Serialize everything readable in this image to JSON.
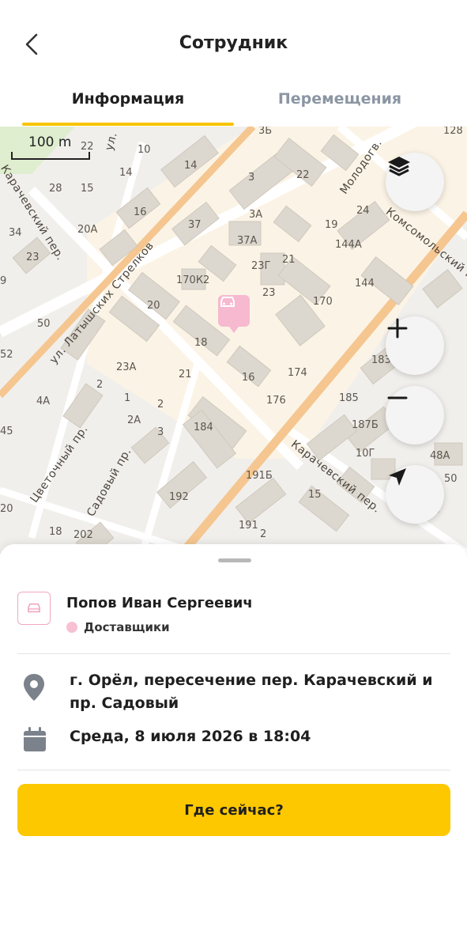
{
  "header": {
    "title": "Сотрудник",
    "back_icon": "chevron-left-icon"
  },
  "tabs": [
    {
      "label": "Информация",
      "active": true
    },
    {
      "label": "Перемещения",
      "active": false
    }
  ],
  "map": {
    "scale_label": "100 m",
    "streets": [
      "ул. Латышских Стрелков",
      "Карачевский пер.",
      "Карачевский пер.",
      "Комсомольский пр.",
      "Молодогв.",
      "Цветочный пр.",
      "Садовый пр.",
      "ул."
    ],
    "house_numbers": [
      "3Б",
      "128",
      "10",
      "22",
      "14",
      "14",
      "3",
      "22",
      "28",
      "15",
      "16",
      "3А",
      "24",
      "19",
      "144А",
      "34",
      "20А",
      "37",
      "37А",
      "21",
      "23Г",
      "144",
      "23",
      "170К2",
      "170",
      "9",
      "23",
      "20",
      "50",
      "18",
      "183",
      "52",
      "23А",
      "21",
      "174",
      "4А",
      "2",
      "1",
      "16",
      "176",
      "185",
      "187Б",
      "45",
      "2А",
      "184",
      "10Г",
      "48А",
      "2",
      "3",
      "191Б",
      "50",
      "15",
      "192",
      "20",
      "18",
      "202",
      "191",
      "2"
    ],
    "buttons": {
      "layers_icon": "layers-icon",
      "zoom_in_icon": "plus-icon",
      "zoom_out_icon": "minus-icon",
      "locate_icon": "navigation-arrow-icon"
    }
  },
  "employee": {
    "name": "Попов Иван Сергеевич",
    "role": "Доставщики",
    "role_color": "#f7c1d3",
    "address": "г. Орёл, пересечение пер. Карачевский и пр. Садовый",
    "datetime": "Среда, 8 июля 2026 в 18:04"
  },
  "actions": {
    "where_now_label": "Где сейчас?"
  },
  "colors": {
    "accent": "#fdc800",
    "tab_inactive": "#8c96a3",
    "marker": "#f6b9cf"
  }
}
